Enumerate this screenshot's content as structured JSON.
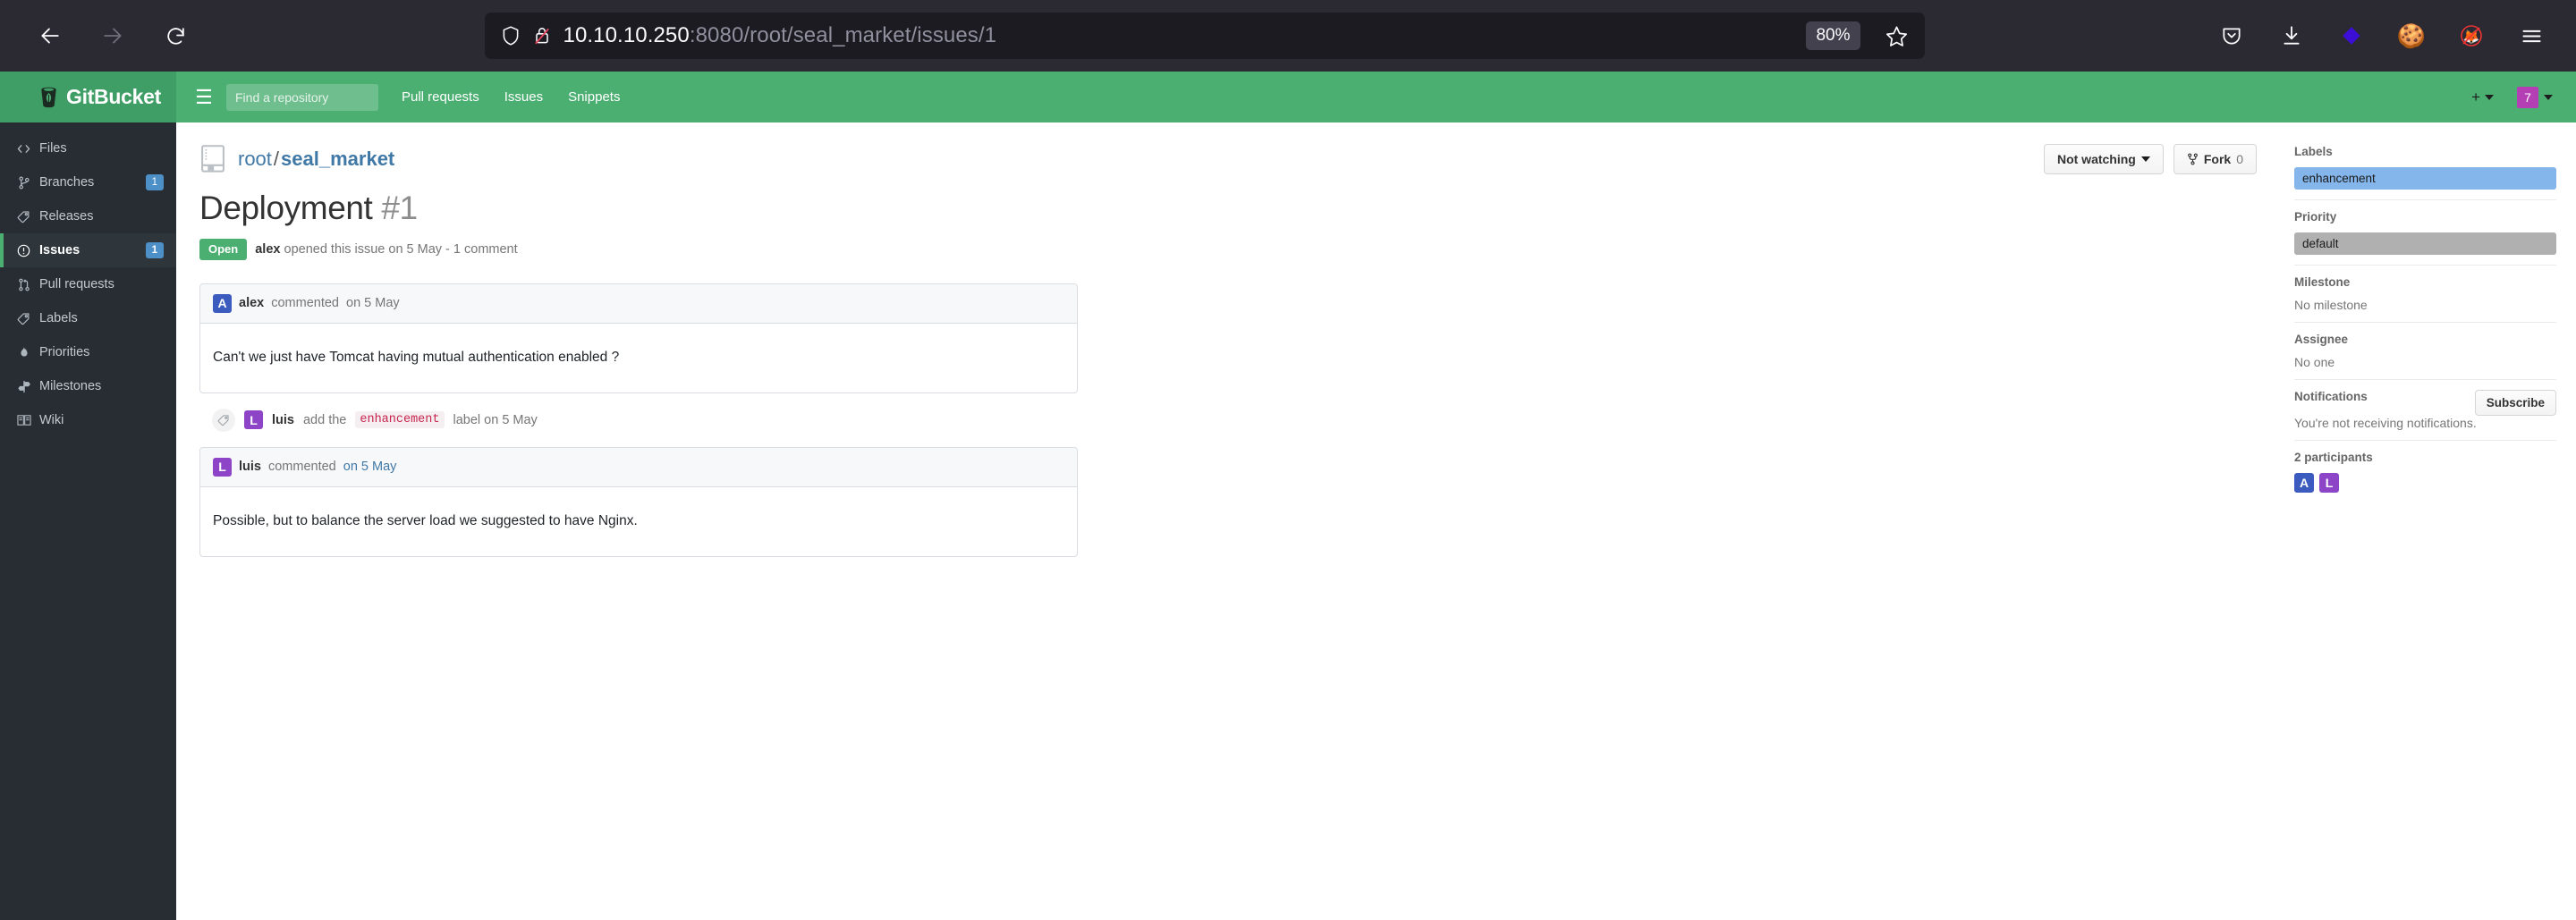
{
  "browser": {
    "url_host": "10.10.10.250",
    "url_rest": ":8080/root/seal_market/issues/1",
    "zoom_level": "80%",
    "back_icon": "back-arrow-icon",
    "forward_icon": "forward-arrow-icon",
    "reload_icon": "reload-icon",
    "shield_icon": "shield-icon",
    "insecure_icon": "broken-lock-icon",
    "bookmark_icon": "star-icon",
    "pocket_icon": "pocket-icon",
    "downloads_icon": "download-icon",
    "extension_icon": "diamond-extension-icon",
    "cookie_icon": "cookie-icon",
    "fox_blocked_icon": "fox-blocked-icon",
    "menu_icon": "hamburger-menu-icon"
  },
  "header": {
    "brand": "GitBucket",
    "menu_toggle": "☰",
    "search_placeholder": "Find a repository",
    "search_value": "",
    "nav": [
      {
        "label": "Pull requests"
      },
      {
        "label": "Issues"
      },
      {
        "label": "Snippets"
      }
    ],
    "plus_label": "+",
    "user_initial": "7",
    "accent": "#4caf72"
  },
  "sidebar": {
    "items": [
      {
        "label": "Files",
        "icon": "code-icon",
        "badge": "",
        "active": false
      },
      {
        "label": "Branches",
        "icon": "branch-icon",
        "badge": "1",
        "active": false
      },
      {
        "label": "Releases",
        "icon": "tag-icon",
        "badge": "",
        "active": false
      },
      {
        "label": "Issues",
        "icon": "issue-icon",
        "badge": "1",
        "active": true
      },
      {
        "label": "Pull requests",
        "icon": "pull-request-icon",
        "badge": "",
        "active": false
      },
      {
        "label": "Labels",
        "icon": "tag-icon",
        "badge": "",
        "active": false
      },
      {
        "label": "Priorities",
        "icon": "flame-icon",
        "badge": "",
        "active": false
      },
      {
        "label": "Milestones",
        "icon": "milestone-icon",
        "badge": "",
        "active": false
      },
      {
        "label": "Wiki",
        "icon": "book-icon",
        "badge": "",
        "active": false
      }
    ]
  },
  "repo": {
    "owner": "root",
    "separator": "/",
    "name": "seal_market",
    "watch_label": "Not watching",
    "fork_label": "Fork",
    "fork_count": "0"
  },
  "issue": {
    "title": "Deployment",
    "number": "#1",
    "state": "Open",
    "meta_author": "alex",
    "meta_text": "opened this issue on 5 May - 1 comment"
  },
  "timeline": [
    {
      "type": "comment",
      "avatar_letter": "A",
      "avatar_color": "av-blue",
      "author": "alex",
      "action": "commented",
      "date": "on 5 May",
      "date_is_link": false,
      "body": "Can't we just have Tomcat having mutual authentication enabled ?"
    },
    {
      "type": "event",
      "icon": "tag-icon",
      "avatar_letter": "L",
      "avatar_color": "av-purple",
      "author": "luis",
      "action_before": "add the",
      "label": "enhancement",
      "action_after": "label on 5 May"
    },
    {
      "type": "comment",
      "avatar_letter": "L",
      "avatar_color": "av-purple",
      "author": "luis",
      "action": "commented",
      "date": "on 5 May",
      "date_is_link": true,
      "body": "Possible, but to balance the server load we suggested to have Nginx."
    }
  ],
  "rsidebar": {
    "labels_head": "Labels",
    "labels": [
      {
        "name": "enhancement",
        "class": "lbl-enhancement",
        "color": "#84b6eb"
      }
    ],
    "priority_head": "Priority",
    "priority": {
      "name": "default",
      "class": "lbl-default",
      "color": "#b0b0b0"
    },
    "milestone_head": "Milestone",
    "milestone_value": "No milestone",
    "assignee_head": "Assignee",
    "assignee_value": "No one",
    "notifications_head": "Notifications",
    "subscribe_label": "Subscribe",
    "notifications_value": "You're not receiving notifications.",
    "participants_head": "2 participants",
    "participants": [
      {
        "letter": "A",
        "class": "av-blue"
      },
      {
        "letter": "L",
        "class": "av-purple"
      }
    ]
  }
}
